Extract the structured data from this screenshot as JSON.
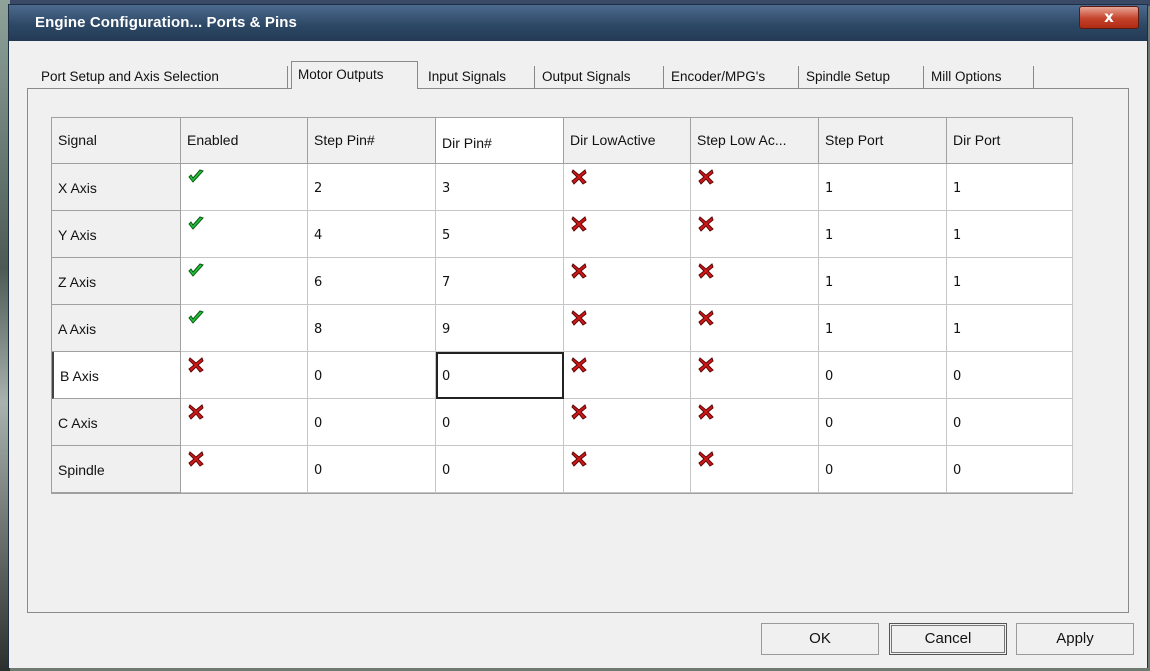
{
  "window": {
    "title": "Engine Configuration... Ports & Pins",
    "close_label": "x"
  },
  "tabs": [
    {
      "label": "Port Setup and Axis Selection"
    },
    {
      "label": "Motor Outputs"
    },
    {
      "label": "Input Signals"
    },
    {
      "label": "Output Signals"
    },
    {
      "label": "Encoder/MPG's"
    },
    {
      "label": "Spindle Setup"
    },
    {
      "label": "Mill Options"
    }
  ],
  "active_tab": "Motor Outputs",
  "grid": {
    "columns": [
      "Signal",
      "Enabled",
      "Step Pin#",
      "Dir Pin#",
      "Dir LowActive",
      "Step Low Ac...",
      "Step Port",
      "Dir Port"
    ],
    "rows": [
      {
        "signal": "X Axis",
        "enabled": "check",
        "step_pin": "2",
        "dir_pin": "3",
        "dir_low_active": "cross",
        "step_low_active": "cross",
        "step_port": "1",
        "dir_port": "1"
      },
      {
        "signal": "Y Axis",
        "enabled": "check",
        "step_pin": "4",
        "dir_pin": "5",
        "dir_low_active": "cross",
        "step_low_active": "cross",
        "step_port": "1",
        "dir_port": "1"
      },
      {
        "signal": "Z Axis",
        "enabled": "check",
        "step_pin": "6",
        "dir_pin": "7",
        "dir_low_active": "cross",
        "step_low_active": "cross",
        "step_port": "1",
        "dir_port": "1"
      },
      {
        "signal": "A Axis",
        "enabled": "check",
        "step_pin": "8",
        "dir_pin": "9",
        "dir_low_active": "cross",
        "step_low_active": "cross",
        "step_port": "1",
        "dir_port": "1"
      },
      {
        "signal": "B Axis",
        "enabled": "cross",
        "step_pin": "0",
        "dir_pin": "0",
        "dir_low_active": "cross",
        "step_low_active": "cross",
        "step_port": "0",
        "dir_port": "0"
      },
      {
        "signal": "C Axis",
        "enabled": "cross",
        "step_pin": "0",
        "dir_pin": "0",
        "dir_low_active": "cross",
        "step_low_active": "cross",
        "step_port": "0",
        "dir_port": "0"
      },
      {
        "signal": "Spindle",
        "enabled": "cross",
        "step_pin": "0",
        "dir_pin": "0",
        "dir_low_active": "cross",
        "step_low_active": "cross",
        "step_port": "0",
        "dir_port": "0"
      }
    ]
  },
  "buttons": {
    "ok": "OK",
    "cancel": "Cancel",
    "apply": "Apply"
  },
  "colors": {
    "check": "#22c33a",
    "cross": "#d01818",
    "titlebar": "#2d4966"
  }
}
